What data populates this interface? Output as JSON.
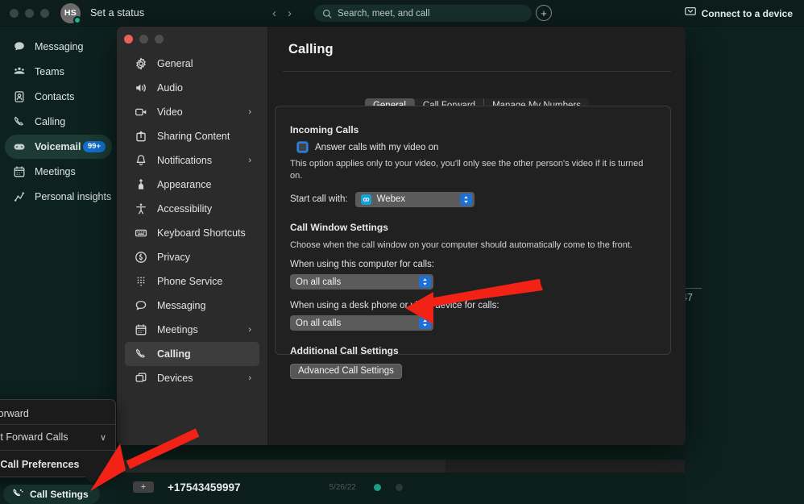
{
  "app": {
    "status_text": "Set a status",
    "avatar_initials": "HS",
    "search_placeholder": "Search, meet, and call",
    "add_label": "+",
    "connect_device": "Connect to a device",
    "nav_back": "‹",
    "nav_forward": "›"
  },
  "sidebar": {
    "items": [
      {
        "label": "Messaging",
        "icon": "chat-icon",
        "active": false,
        "badge": ""
      },
      {
        "label": "Teams",
        "icon": "teams-icon",
        "active": false,
        "badge": ""
      },
      {
        "label": "Contacts",
        "icon": "contacts-icon",
        "active": false,
        "badge": ""
      },
      {
        "label": "Calling",
        "icon": "phone-icon",
        "active": false,
        "badge": ""
      },
      {
        "label": "Voicemail",
        "icon": "voicemail-icon",
        "active": true,
        "badge": "99+"
      },
      {
        "label": "Meetings",
        "icon": "calendar-icon",
        "active": false,
        "badge": ""
      },
      {
        "label": "Personal insights",
        "icon": "insights-icon",
        "active": false,
        "badge": ""
      }
    ]
  },
  "background": {
    "phone_number": "+17543459997",
    "date": "5/26/22",
    "plus_label": "+",
    "right_number": "47"
  },
  "popover": {
    "title": "Call Forward",
    "selected": "Do Not Forward Calls",
    "action": "Open Call Preferences",
    "chevron": "∨",
    "button_label": "Call Settings"
  },
  "settings_window": {
    "nav": [
      {
        "label": "General",
        "icon": "gear-icon",
        "chevron": false,
        "active": false
      },
      {
        "label": "Audio",
        "icon": "speaker-icon",
        "chevron": false,
        "active": false
      },
      {
        "label": "Video",
        "icon": "camera-icon",
        "chevron": true,
        "active": false
      },
      {
        "label": "Sharing Content",
        "icon": "share-icon",
        "chevron": false,
        "active": false
      },
      {
        "label": "Notifications",
        "icon": "bell-icon",
        "chevron": true,
        "active": false
      },
      {
        "label": "Appearance",
        "icon": "appearance-icon",
        "chevron": false,
        "active": false
      },
      {
        "label": "Accessibility",
        "icon": "accessibility-icon",
        "chevron": false,
        "active": false
      },
      {
        "label": "Keyboard Shortcuts",
        "icon": "keyboard-icon",
        "chevron": false,
        "active": false
      },
      {
        "label": "Privacy",
        "icon": "privacy-icon",
        "chevron": false,
        "active": false
      },
      {
        "label": "Phone Service",
        "icon": "dialpad-icon",
        "chevron": false,
        "active": false
      },
      {
        "label": "Messaging",
        "icon": "message-icon",
        "chevron": false,
        "active": false
      },
      {
        "label": "Meetings",
        "icon": "calendar-icon",
        "chevron": true,
        "active": false
      },
      {
        "label": "Calling",
        "icon": "phone-icon",
        "chevron": false,
        "active": true
      },
      {
        "label": "Devices",
        "icon": "devices-icon",
        "chevron": true,
        "active": false
      }
    ],
    "page_title": "Calling",
    "tabs": [
      {
        "label": "General",
        "active": true
      },
      {
        "label": "Call Forward",
        "active": false
      },
      {
        "label": "Manage My Numbers",
        "active": false
      }
    ],
    "incoming": {
      "heading": "Incoming Calls",
      "checkbox_label": "Answer calls with my video on",
      "checkbox_checked": false,
      "hint": "This option applies only to your video, you'll only see the other person's video if it is turned on.",
      "start_call_label": "Start call with:",
      "start_call_value": "Webex"
    },
    "call_window": {
      "heading": "Call Window Settings",
      "description": "Choose when the call window on your computer should automatically come to the front.",
      "label_computer": "When using this computer for calls:",
      "value_computer": "On all calls",
      "label_device": "When using a desk phone or video device for calls:",
      "value_device": "On all calls"
    },
    "additional": {
      "heading": "Additional Call Settings",
      "button_label": "Advanced Call Settings"
    }
  },
  "colors": {
    "app_bg": "#0d1f1c",
    "sidebar_bg": "#0d2220",
    "accent_blue": "#1170cf",
    "modal_bg": "#1e1e1e",
    "modal_side_bg": "#2b2b2b",
    "annotation_red": "#f22216",
    "presence_green": "#1ab394"
  }
}
